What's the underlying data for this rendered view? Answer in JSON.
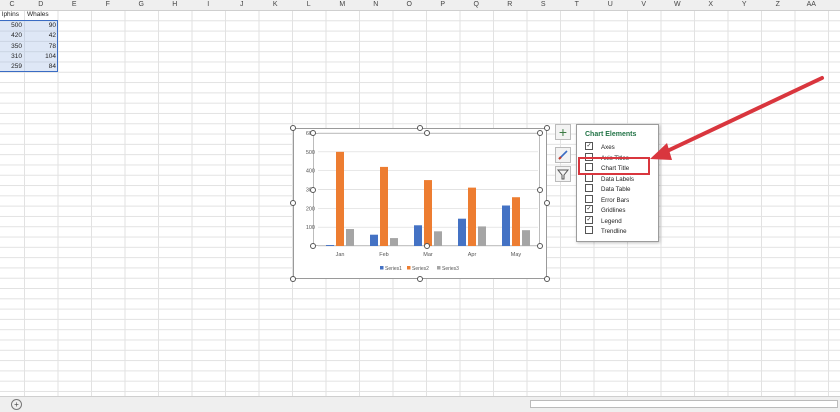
{
  "columns": [
    "C",
    "D",
    "E",
    "F",
    "G",
    "H",
    "I",
    "J",
    "K",
    "L",
    "M",
    "N",
    "O",
    "P",
    "Q",
    "R",
    "S",
    "T",
    "U",
    "V",
    "W",
    "X",
    "Y",
    "Z",
    "AA"
  ],
  "table": {
    "headers": [
      "lphins",
      "Whales"
    ],
    "rows": [
      [
        "500",
        "90"
      ],
      [
        "420",
        "42"
      ],
      [
        "350",
        "78"
      ],
      [
        "310",
        "104"
      ],
      [
        "259",
        "84"
      ]
    ]
  },
  "chart_data": {
    "type": "bar",
    "categories": [
      "Jan",
      "Feb",
      "Mar",
      "Apr",
      "May"
    ],
    "series": [
      {
        "name": "Series1",
        "values": [
          5,
          60,
          110,
          145,
          215
        ],
        "color": "#4472c4"
      },
      {
        "name": "Series2",
        "values": [
          500,
          420,
          350,
          310,
          259
        ],
        "color": "#ed7d31"
      },
      {
        "name": "Series3",
        "values": [
          90,
          42,
          78,
          104,
          84
        ],
        "color": "#a5a5a5"
      }
    ],
    "yticks": [
      "0",
      "100",
      "200",
      "300",
      "400",
      "500",
      "600"
    ],
    "ylim": [
      0,
      600
    ],
    "grid": true,
    "legend_position": "bottom"
  },
  "chart_tools": {
    "add_element": "+",
    "style": "brush",
    "filter": "funnel"
  },
  "panel": {
    "title": "Chart Elements",
    "items": [
      {
        "label": "Axes",
        "checked": true
      },
      {
        "label": "Axis Titles",
        "checked": false
      },
      {
        "label": "Chart Title",
        "checked": false
      },
      {
        "label": "Data Labels",
        "checked": false
      },
      {
        "label": "Data Table",
        "checked": false
      },
      {
        "label": "Error Bars",
        "checked": false
      },
      {
        "label": "Gridlines",
        "checked": true
      },
      {
        "label": "Legend",
        "checked": true
      },
      {
        "label": "Trendline",
        "checked": false
      }
    ]
  },
  "status_bar": {
    "add_sheet": "+"
  },
  "colors": {
    "highlight": "#d9363e",
    "arrow": "#d9363e",
    "panel_title": "#217346"
  }
}
